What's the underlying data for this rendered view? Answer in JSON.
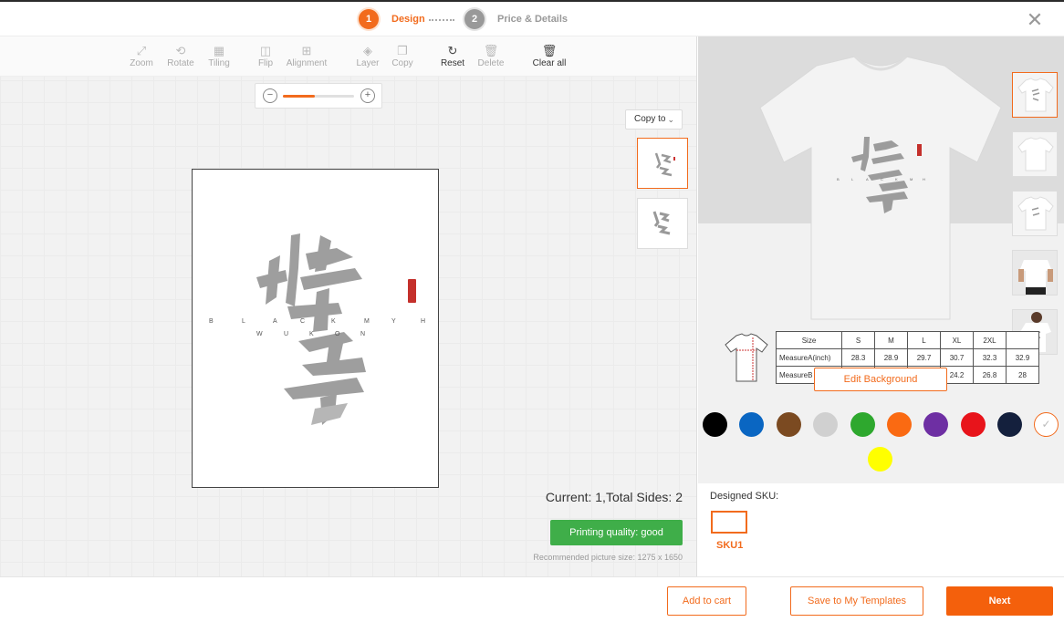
{
  "steps": [
    {
      "number": "1",
      "label": "Design",
      "active": true
    },
    {
      "number": "2",
      "label": "Price & Details",
      "active": false
    }
  ],
  "close_icon": "close-icon",
  "toolbar": {
    "zoom": "Zoom",
    "rotate": "Rotate",
    "tiling": "Tiling",
    "flip": "Flip",
    "alignment": "Alignment",
    "layer": "Layer",
    "copy": "Copy",
    "reset": "Reset",
    "delete": "Delete",
    "clear_all": "Clear all"
  },
  "zoom": {
    "level": 0.45
  },
  "copy_to": "Copy to",
  "sides_text": "Current: 1,Total Sides: 2",
  "quality_label": "Printing quality: good",
  "recommended_size": "Recommended picture size: 1275 x 1650",
  "size_table": {
    "headers": [
      "Size",
      "S",
      "M",
      "L",
      "XL",
      "2XL",
      ""
    ],
    "rows": [
      [
        "MeasureA(inch)",
        "28.3",
        "28.9",
        "29.7",
        "30.7",
        "32.3",
        "32.9"
      ],
      [
        "MeasureB",
        "",
        "",
        "",
        "24.2",
        "26.8",
        "28"
      ]
    ]
  },
  "edit_background": "Edit Background",
  "colors": {
    "accent": "#f26b1d",
    "swatches": [
      "#000000",
      "#0a66c2",
      "#7b4a21",
      "#d0d0d0",
      "#2ea82e",
      "#fa6a12",
      "#6e2fa3",
      "#e8141b",
      "#14203d",
      "#ffffff",
      "#ffff00"
    ]
  },
  "designed_sku_label": "Designed SKU:",
  "sku_name": "SKU1",
  "buttons": {
    "add_to_cart": "Add to cart",
    "save_templates": "Save to My Templates",
    "next": "Next"
  }
}
